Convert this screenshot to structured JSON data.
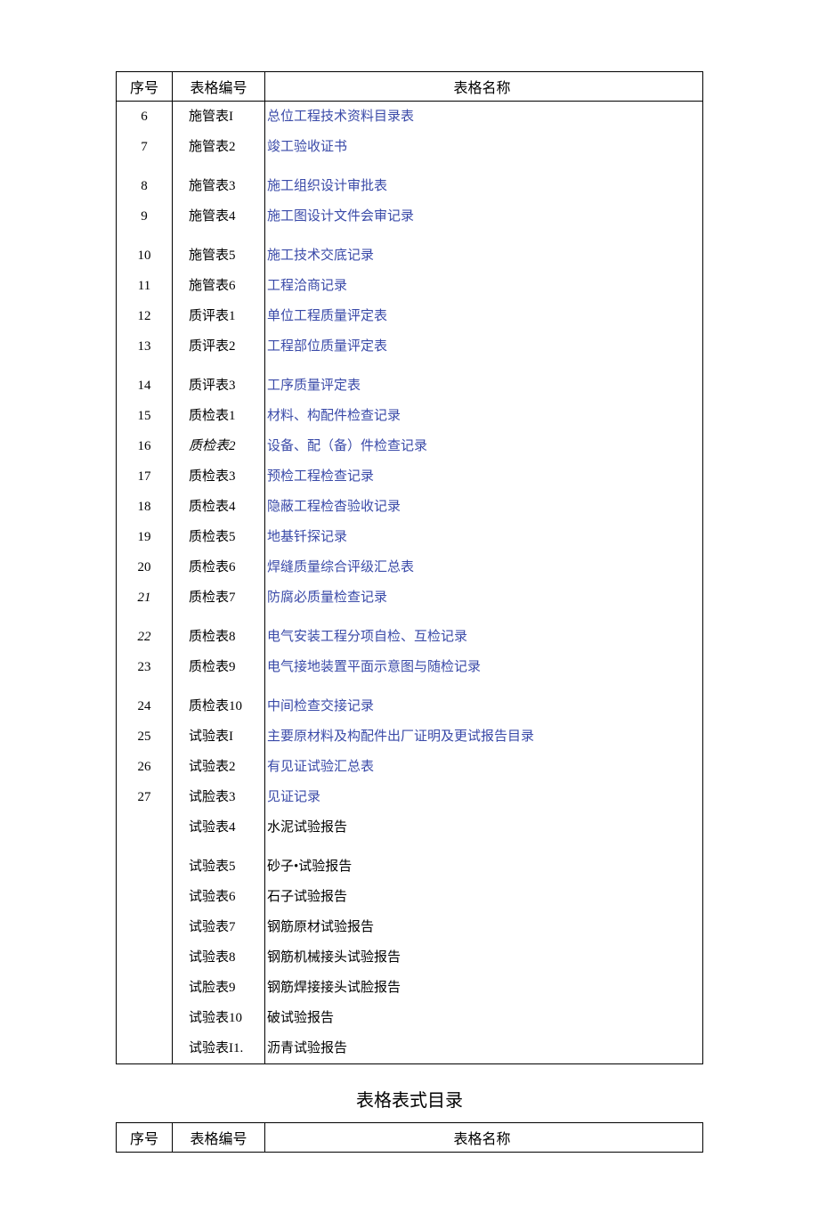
{
  "table1": {
    "headers": {
      "seq": "序号",
      "id": "表格编号",
      "name": "表格名称"
    },
    "rows": [
      {
        "seq": "6",
        "id": "施管表I",
        "name": "总位工程技术资料目录表",
        "link": true,
        "seq_italic": false,
        "id_italic": false,
        "gap_before": false
      },
      {
        "seq": "7",
        "id": "施管表2",
        "name": "竣工验收证书",
        "link": true,
        "seq_italic": false,
        "id_italic": false,
        "gap_before": false
      },
      {
        "seq": "8",
        "id": "施管表3",
        "name": "施工组织设计审批表",
        "link": true,
        "seq_italic": false,
        "id_italic": false,
        "gap_before": true
      },
      {
        "seq": "9",
        "id": "施管表4",
        "name": "施工图设计文件会审记录",
        "link": true,
        "seq_italic": false,
        "id_italic": false,
        "gap_before": false
      },
      {
        "seq": "10",
        "id": "施管表5",
        "name": "施工技术交底记录",
        "link": true,
        "seq_italic": false,
        "id_italic": false,
        "gap_before": true
      },
      {
        "seq": "11",
        "id": "施管表6",
        "name": "工程洽商记录",
        "link": true,
        "seq_italic": false,
        "id_italic": false,
        "gap_before": false
      },
      {
        "seq": "12",
        "id": "质评表1",
        "name": "单位工程质量评定表",
        "link": true,
        "seq_italic": false,
        "id_italic": false,
        "gap_before": false
      },
      {
        "seq": "13",
        "id": "质评表2",
        "name": "工程部位质量评定表",
        "link": true,
        "seq_italic": false,
        "id_italic": false,
        "gap_before": false
      },
      {
        "seq": "14",
        "id": "质评表3",
        "name": "工序质量评定表",
        "link": true,
        "seq_italic": false,
        "id_italic": false,
        "gap_before": true
      },
      {
        "seq": "15",
        "id": "质检表1",
        "name": "材料、构配件检查记录",
        "link": true,
        "seq_italic": false,
        "id_italic": false,
        "gap_before": false
      },
      {
        "seq": "16",
        "id": "质检表2",
        "name": "设备、配（备）件检查记录",
        "link": true,
        "seq_italic": false,
        "id_italic": true,
        "gap_before": false
      },
      {
        "seq": "17",
        "id": "质检表3",
        "name": "预检工程检查记录",
        "link": true,
        "seq_italic": false,
        "id_italic": false,
        "gap_before": false
      },
      {
        "seq": "18",
        "id": "质检表4",
        "name": "隐蔽工程检杳验收记录",
        "link": true,
        "seq_italic": false,
        "id_italic": false,
        "gap_before": false
      },
      {
        "seq": "19",
        "id": "质检表5",
        "name": "地基钎探记录",
        "link": true,
        "seq_italic": false,
        "id_italic": false,
        "gap_before": false
      },
      {
        "seq": "20",
        "id": "质检表6",
        "name": "焊缝质量综合评级汇总表",
        "link": true,
        "seq_italic": false,
        "id_italic": false,
        "gap_before": false
      },
      {
        "seq": "21",
        "id": "质检表7",
        "name": "防腐必质量检查记录",
        "link": true,
        "seq_italic": true,
        "id_italic": false,
        "gap_before": false
      },
      {
        "seq": "22",
        "id": "质检表8",
        "name": "电气安装工程分项自检、互检记录",
        "link": true,
        "seq_italic": true,
        "id_italic": false,
        "gap_before": true
      },
      {
        "seq": "23",
        "id": "质检表9",
        "name": "电气接地装置平面示意图与随检记录",
        "link": true,
        "seq_italic": false,
        "id_italic": false,
        "gap_before": false
      },
      {
        "seq": "24",
        "id": "质检表10",
        "name": "中间检查交接记录",
        "link": true,
        "seq_italic": false,
        "id_italic": false,
        "gap_before": true
      },
      {
        "seq": "25",
        "id": "试验表I",
        "name": "主要原材料及构配件出厂证明及更试报告目录",
        "link": true,
        "seq_italic": false,
        "id_italic": false,
        "gap_before": false
      },
      {
        "seq": "26",
        "id": "试验表2",
        "name": "有见证试验汇总表",
        "link": true,
        "seq_italic": false,
        "id_italic": false,
        "gap_before": false
      },
      {
        "seq": "27",
        "id": "试脸表3",
        "name": "见证记录",
        "link": true,
        "seq_italic": false,
        "id_italic": false,
        "gap_before": false
      },
      {
        "seq": "",
        "id": "试验表4",
        "name": "水泥试验报告",
        "link": false,
        "seq_italic": false,
        "id_italic": false,
        "gap_before": false
      },
      {
        "seq": "",
        "id": "试验表5",
        "name": "砂子•试验报告",
        "link": false,
        "seq_italic": false,
        "id_italic": false,
        "gap_before": true
      },
      {
        "seq": "",
        "id": "试验表6",
        "name": "石子试验报告",
        "link": false,
        "seq_italic": false,
        "id_italic": false,
        "gap_before": false
      },
      {
        "seq": "",
        "id": "试验表7",
        "name": "钢筋原材试验报告",
        "link": false,
        "seq_italic": false,
        "id_italic": false,
        "gap_before": false
      },
      {
        "seq": "",
        "id": "试验表8",
        "name": "钢筋机械接头试验报告",
        "link": false,
        "seq_italic": false,
        "id_italic": false,
        "gap_before": false
      },
      {
        "seq": "",
        "id": "试脸表9",
        "name": "钢筋焊接接头试脸报告",
        "link": false,
        "seq_italic": false,
        "id_italic": false,
        "gap_before": false
      },
      {
        "seq": "",
        "id": "试验表10",
        "name": "破试验报告",
        "link": false,
        "seq_italic": false,
        "id_italic": false,
        "gap_before": false
      },
      {
        "seq": "",
        "id": "试验表I1.",
        "name": "沥青试验报告",
        "link": false,
        "seq_italic": false,
        "id_italic": false,
        "gap_before": false
      }
    ]
  },
  "section_title": "表格表式目录",
  "table2": {
    "headers": {
      "seq": "序号",
      "id": "表格编号",
      "name": "表格名称"
    }
  }
}
